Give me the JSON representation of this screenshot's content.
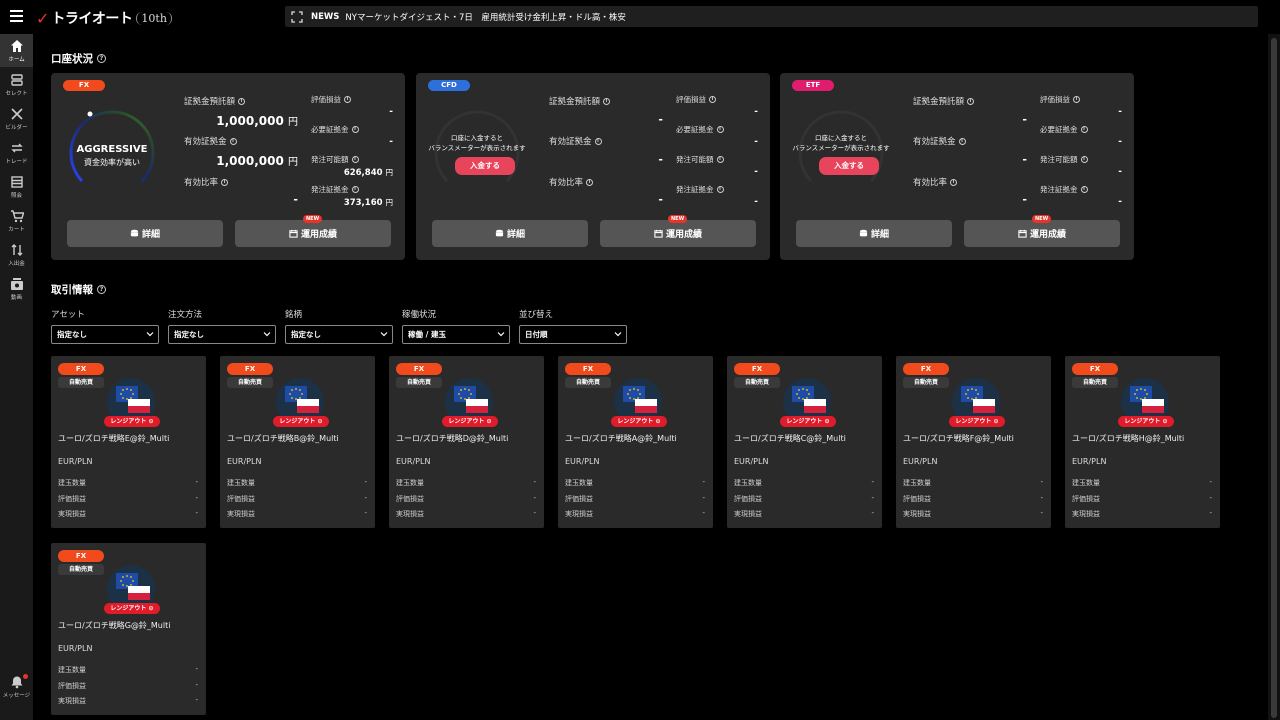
{
  "header": {
    "logo_text": "トライオート",
    "logo_badge": "10th",
    "news_label": "NEWS",
    "news_text": "NYマーケットダイジェスト・7日　雇用統計受け金利上昇・ドル高・株安"
  },
  "sidebar": {
    "items": [
      {
        "label": "ホーム",
        "icon": "home-icon"
      },
      {
        "label": "セレクト",
        "icon": "select-icon"
      },
      {
        "label": "ビルダー",
        "icon": "builder-icon"
      },
      {
        "label": "トレード",
        "icon": "trade-icon"
      },
      {
        "label": "照会",
        "icon": "inquiry-icon"
      },
      {
        "label": "カート",
        "icon": "cart-icon"
      },
      {
        "label": "入出金",
        "icon": "deposit-icon"
      },
      {
        "label": "動画",
        "icon": "video-icon"
      }
    ],
    "message_label": "メッセージ"
  },
  "account": {
    "title": "口座状況",
    "labels": {
      "deposit": "証拠金預託額",
      "effective": "有効証拠金",
      "ratio": "有効比率",
      "pl": "評価損益",
      "required": "必要証拠金",
      "orderable": "発注可能額",
      "order_margin": "発注証拠金",
      "detail_btn": "詳細",
      "perf_btn": "運用成績",
      "new_badge": "NEW",
      "yen": "円"
    },
    "fx": {
      "tag": "FX",
      "gauge_title": "AGGRESSIVE",
      "gauge_sub": "資金効率が高い",
      "deposit": "1,000,000",
      "effective": "1,000,000",
      "ratio": "-",
      "pl": "-",
      "required": "-",
      "orderable": "626,840",
      "order_margin": "373,160"
    },
    "cfd": {
      "tag": "CFD",
      "gauge_msg1": "口座に入金すると",
      "gauge_msg2": "バランスメーターが表示されます",
      "deposit_btn": "入金する",
      "deposit": "-",
      "effective": "-",
      "ratio": "-",
      "pl": "-",
      "required": "-",
      "orderable": "-",
      "order_margin": "-"
    },
    "etf": {
      "tag": "ETF",
      "gauge_msg1": "口座に入金すると",
      "gauge_msg2": "バランスメーターが表示されます",
      "deposit_btn": "入金する",
      "deposit": "-",
      "effective": "-",
      "ratio": "-",
      "pl": "-",
      "required": "-",
      "orderable": "-",
      "order_margin": "-"
    }
  },
  "trades": {
    "title": "取引情報",
    "filters": [
      {
        "label": "アセット",
        "value": "指定なし"
      },
      {
        "label": "注文方法",
        "value": "指定なし"
      },
      {
        "label": "銘柄",
        "value": "指定なし"
      },
      {
        "label": "稼働状況",
        "value": "稼働 / 建玉"
      },
      {
        "label": "並び替え",
        "value": "日付順"
      }
    ],
    "card_labels": {
      "tag": "FX",
      "auto": "自動売買",
      "rangeout": "レンジアウト",
      "pair": "EUR/PLN",
      "qty": "建玉数量",
      "pl": "評価損益",
      "realized": "実現損益"
    },
    "cards": [
      {
        "name": "ユーロ/ズロチ戦略E@鈴_Multi",
        "qty": "-",
        "pl": "-",
        "realized": "-"
      },
      {
        "name": "ユーロ/ズロチ戦略B@鈴_Multi",
        "qty": "-",
        "pl": "-",
        "realized": "-"
      },
      {
        "name": "ユーロ/ズロチ戦略D@鈴_Multi",
        "qty": "-",
        "pl": "-",
        "realized": "-"
      },
      {
        "name": "ユーロ/ズロチ戦略A@鈴_Multi",
        "qty": "-",
        "pl": "-",
        "realized": "-"
      },
      {
        "name": "ユーロ/ズロチ戦略C@鈴_Multi",
        "qty": "-",
        "pl": "-",
        "realized": "-"
      },
      {
        "name": "ユーロ/ズロチ戦略F@鈴_Multi",
        "qty": "-",
        "pl": "-",
        "realized": "-"
      },
      {
        "name": "ユーロ/ズロチ戦略H@鈴_Multi",
        "qty": "-",
        "pl": "-",
        "realized": "-"
      },
      {
        "name": "ユーロ/ズロチ戦略G@鈴_Multi",
        "qty": "-",
        "pl": "-",
        "realized": "-"
      }
    ]
  }
}
